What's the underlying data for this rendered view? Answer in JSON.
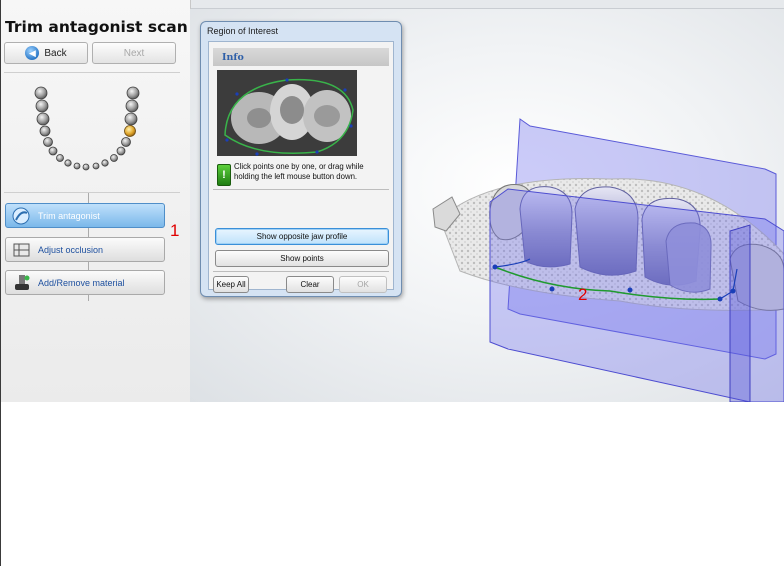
{
  "left_panel": {
    "title": "Trim antagonist scan",
    "back_label": "Back",
    "next_label": "Next",
    "steps": [
      {
        "label": "Trim antagonist",
        "icon": "scanner-icon",
        "active": true
      },
      {
        "label": "Adjust occlusion",
        "icon": "occlusion-icon",
        "active": false
      },
      {
        "label": "Add/Remove material",
        "icon": "material-icon",
        "active": false
      }
    ],
    "annotation": "1"
  },
  "dialog": {
    "title": "Region of Interest",
    "info_header": "Info",
    "hint_text": "Click points one by one, or drag while holding the left mouse button down.",
    "show_opposite_label": "Show opposite jaw profile",
    "show_points_label": "Show points",
    "keep_all_label": "Keep All",
    "clear_label": "Clear",
    "ok_label": "OK"
  },
  "viewport": {
    "annotation": "2"
  },
  "colors": {
    "accent_blue": "#7ab8ea",
    "annotation_red": "#e00000",
    "roi_box": "#6f6ff0",
    "trim_line": "#1f9a2e"
  }
}
